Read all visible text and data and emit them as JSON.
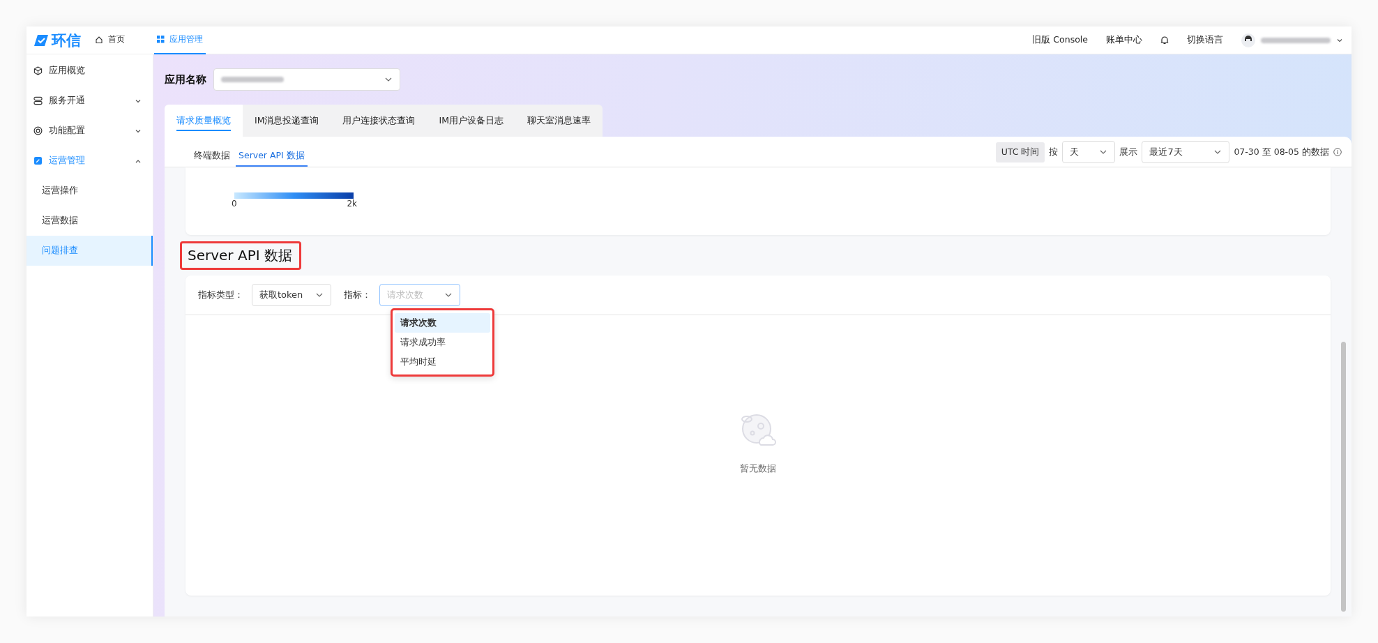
{
  "top_bar": {
    "logo": "环信",
    "nav": [
      {
        "label": "首页",
        "selected": false
      },
      {
        "label": "应用管理",
        "selected": true
      }
    ],
    "right_items": [
      {
        "kind": "link",
        "label": "旧版 Console"
      },
      {
        "kind": "link",
        "label": "账单中心"
      },
      {
        "kind": "bell"
      },
      {
        "kind": "link",
        "label": "切换语言"
      },
      {
        "kind": "user"
      }
    ]
  },
  "sidebar": {
    "items": [
      {
        "kind": "link",
        "label": "应用概览",
        "selected": false
      },
      {
        "kind": "group",
        "label": "服务开通",
        "expanded": false,
        "selected": false
      },
      {
        "kind": "group",
        "label": "功能配置",
        "expanded": false,
        "selected": false
      },
      {
        "kind": "group",
        "label": "运营管理",
        "expanded": true,
        "selected": false,
        "children": [
          {
            "label": "运营操作",
            "selected": false
          },
          {
            "label": "运营数据",
            "selected": false
          },
          {
            "label": "问题排查",
            "selected": true
          }
        ]
      }
    ]
  },
  "app_selector": {
    "label": "应用名称"
  },
  "tabs": [
    {
      "label": "请求质量概览",
      "selected": true
    },
    {
      "label": "IM消息投递查询",
      "selected": false
    },
    {
      "label": "用户连接状态查询",
      "selected": false
    },
    {
      "label": "IM用户设备日志",
      "selected": false
    },
    {
      "label": "聊天室消息速率",
      "selected": false
    }
  ],
  "sub_tabs": [
    {
      "label": "终端数据",
      "selected": false
    },
    {
      "label": "Server API 数据",
      "selected": true
    }
  ],
  "toolbar": {
    "utc": "UTC 时间",
    "by_label": "按",
    "granularity": "天",
    "show_label": "展示",
    "range": "最近7天",
    "summary": "07-30 至 08-05 的数据"
  },
  "legend": {
    "min": "0",
    "max": "2k"
  },
  "server_api": {
    "title": "Server API 数据",
    "highlighted": true,
    "type_label": "指标类型：",
    "type_value": "获取token",
    "metric_label": "指标：",
    "metric_placeholder": "请求次数",
    "dropdown": {
      "highlighted": true,
      "options": [
        {
          "label": "请求次数",
          "selected": true
        },
        {
          "label": "请求成功率",
          "selected": false
        },
        {
          "label": "平均时延",
          "selected": false
        }
      ]
    },
    "empty": "暂无数据"
  }
}
